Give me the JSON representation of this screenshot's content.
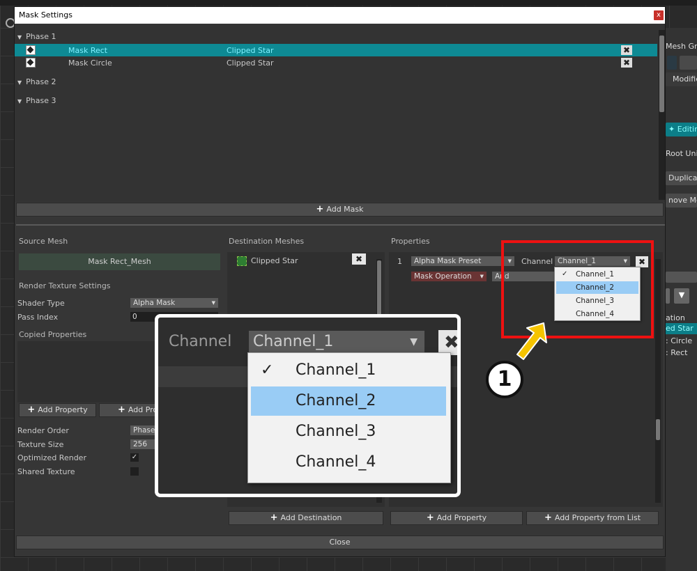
{
  "dialog": {
    "title": "Mask Settings",
    "close_glyph": "x"
  },
  "phases": [
    {
      "label": "Phase 1"
    },
    {
      "label": "Phase 2"
    },
    {
      "label": "Phase 3"
    }
  ],
  "masks": [
    {
      "name": "Mask Rect",
      "target": "Clipped Star",
      "selected": true
    },
    {
      "name": "Mask Circle",
      "target": "Clipped Star",
      "selected": false
    }
  ],
  "add_mask_label": "Add Mask",
  "source": {
    "header": "Source Mesh",
    "mesh_name": "Mask Rect_Mesh",
    "render_texture_header": "Render Texture Settings",
    "shader_type_label": "Shader Type",
    "shader_type_value": "Alpha Mask",
    "pass_index_label": "Pass Index",
    "pass_index_value": "0",
    "copied_properties_header": "Copied Properties",
    "add_property_label": "Add Property",
    "add_property_truncated": "Add Prop",
    "render_order_label": "Render Order",
    "render_order_value": "Phase",
    "texture_size_label": "Texture Size",
    "texture_size_value": "256",
    "optimized_render_label": "Optimized Render",
    "optimized_render_checked": "✓",
    "shared_texture_label": "Shared Texture"
  },
  "destination": {
    "header": "Destination Meshes",
    "items": [
      {
        "name": "Clipped Star"
      }
    ],
    "add_label": "Add Destination"
  },
  "properties": {
    "header": "Properties",
    "row_index": "1",
    "preset_value": "Alpha Mask Preset",
    "channel_label": "Channel",
    "channel_value": "Channel_1",
    "operation_value": "Mask Operation",
    "operation_second": "And",
    "add_label": "Add Property",
    "add_from_list_label": "Add Property from List"
  },
  "channel_options": [
    {
      "label": "Channel_1",
      "checked": true,
      "highlighted": false
    },
    {
      "label": "Channel_2",
      "checked": false,
      "highlighted": true
    },
    {
      "label": "Channel_3",
      "checked": false,
      "highlighted": false
    },
    {
      "label": "Channel_4",
      "checked": false,
      "highlighted": false
    }
  ],
  "close_label": "Close",
  "side_panel": {
    "mesh_group": "Mesh Gro",
    "modifier": "Modifie",
    "editing": "Editing",
    "root_unit": "Root Unit",
    "duplicate": "Duplicate",
    "remove_mesh": "nove Mes",
    "item_ation": "ation",
    "item_star": "ed Star",
    "item_circle": ": Circle",
    "item_rect": ": Rect"
  },
  "callout": {
    "number": "1"
  },
  "colors": {
    "selection": "#0e8a94",
    "highlight_red": "#ee1111",
    "arrow_yellow": "#f5c400",
    "popup_highlight": "#99ccf5"
  }
}
